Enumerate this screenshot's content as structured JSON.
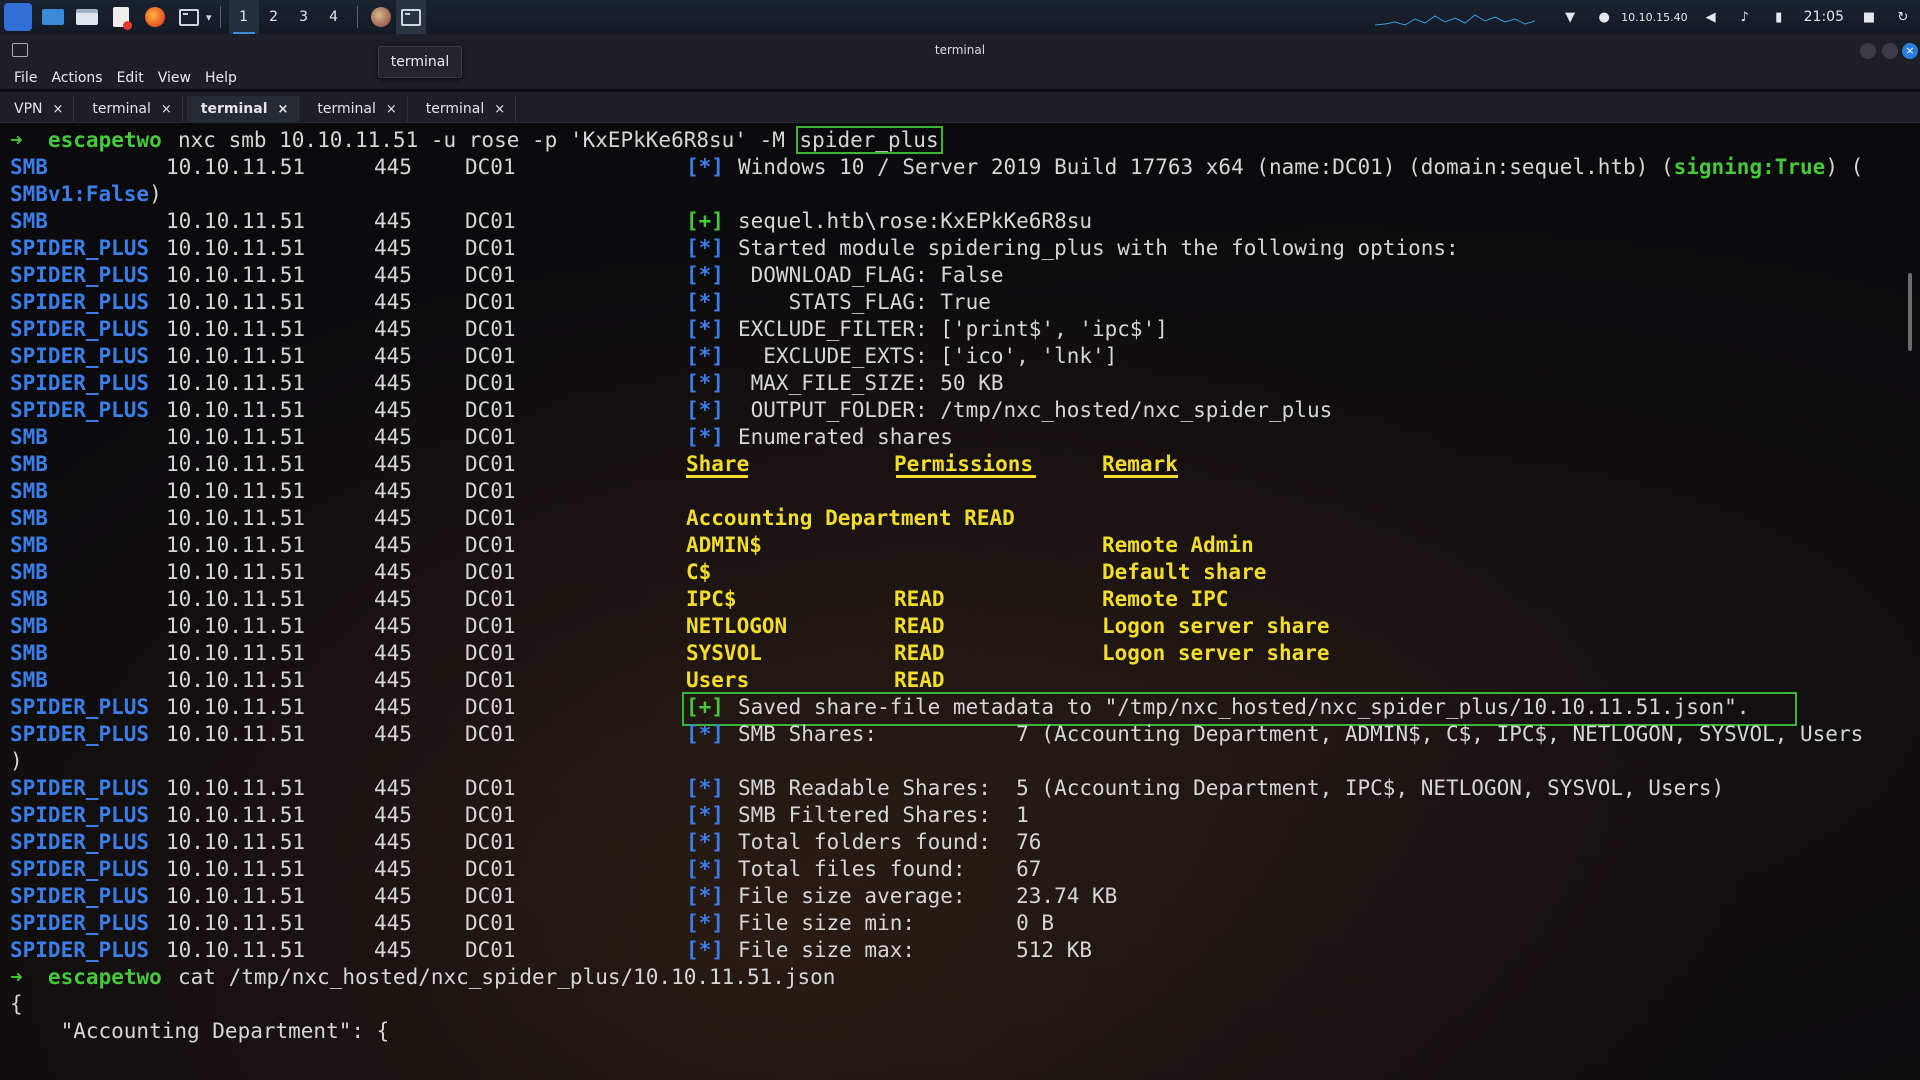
{
  "panel": {
    "workspaces": [
      "1",
      "2",
      "3",
      "4"
    ],
    "active_workspace": "1",
    "ip_address": "10.10.15.40",
    "clock": "21:05",
    "icons": [
      "kali-menu-icon",
      "desktop-icon",
      "file-manager-icon",
      "text-editor-icon",
      "firefox-icon",
      "terminal-icon",
      "wifi-icon",
      "vpn-user-icon",
      "volume-icon",
      "bell-icon",
      "battery-icon",
      "lock-icon",
      "refresh-icon"
    ]
  },
  "window": {
    "title": "terminal",
    "tooltip": "terminal",
    "menu": [
      "File",
      "Actions",
      "Edit",
      "View",
      "Help"
    ],
    "tabs": [
      {
        "label": "VPN",
        "active": false
      },
      {
        "label": "terminal",
        "active": false
      },
      {
        "label": "terminal",
        "active": true
      },
      {
        "label": "terminal",
        "active": false
      },
      {
        "label": "terminal",
        "active": false
      }
    ],
    "close_glyph": "×"
  },
  "terminal": {
    "prompt_arrow": "➜",
    "prompt_name": "escapetwo",
    "command1": "nxc smb 10.10.11.51 -u rose -p 'KxEPkKe6R8su' -M ",
    "command1_highlight": "spider_plus",
    "command2": "cat /tmp/nxc_hosted/nxc_spider_plus/10.10.11.51.json",
    "ip": "10.10.11.51",
    "port": "445",
    "host": "DC01",
    "info_tag": "[*]",
    "plus_tag": "[+]",
    "line_os": "Windows 10 / Server 2019 Build 17763 x64 (name:DC01) (domain:sequel.htb) (",
    "line_os_signing": "signing:True",
    "line_os_end": ") (",
    "line_os_wrap": "SMBv1:False",
    "line_os_wrap_end": ")",
    "creds": "sequel.htb\\rose:KxEPkKe6R8su",
    "module_lines": [
      {
        "prefix": "SPIDER_PLUS",
        "text": "Started module spidering_plus with the following options:"
      },
      {
        "prefix": "SPIDER_PLUS",
        "text": " DOWNLOAD_FLAG: False"
      },
      {
        "prefix": "SPIDER_PLUS",
        "text": "    STATS_FLAG: True"
      },
      {
        "prefix": "SPIDER_PLUS",
        "text": "EXCLUDE_FILTER: ['print$', 'ipc$']"
      },
      {
        "prefix": "SPIDER_PLUS",
        "text": "  EXCLUDE_EXTS: ['ico', 'lnk']"
      },
      {
        "prefix": "SPIDER_PLUS",
        "text": " MAX_FILE_SIZE: 50 KB"
      },
      {
        "prefix": "SPIDER_PLUS",
        "text": " OUTPUT_FOLDER: /tmp/nxc_hosted/nxc_spider_plus"
      }
    ],
    "enumerated": "Enumerated shares",
    "share_headers": [
      "Share",
      "Permissions",
      "Remark"
    ],
    "shares": [
      {
        "share": "Accounting Department",
        "perm": "READ",
        "remark": ""
      },
      {
        "share": "ADMIN$",
        "perm": "",
        "remark": "Remote Admin"
      },
      {
        "share": "C$",
        "perm": "",
        "remark": "Default share"
      },
      {
        "share": "IPC$",
        "perm": "READ",
        "remark": "Remote IPC"
      },
      {
        "share": "NETLOGON",
        "perm": "READ",
        "remark": "Logon server share"
      },
      {
        "share": "SYSVOL",
        "perm": "READ",
        "remark": "Logon server share"
      },
      {
        "share": "Users",
        "perm": "READ",
        "remark": ""
      }
    ],
    "saved": "Saved share-file metadata to \"/tmp/nxc_hosted/nxc_spider_plus/10.10.11.51.json\".",
    "smb_shares": "SMB Shares:           7 (Accounting Department, ADMIN$, C$, IPC$, NETLOGON, SYSVOL, Users",
    "smb_shares_wrap": ")",
    "stats": [
      "SMB Readable Shares:  5 (Accounting Department, IPC$, NETLOGON, SYSVOL, Users)",
      "SMB Filtered Shares:  1",
      "Total folders found:  76",
      "Total files found:    67",
      "File size average:    23.74 KB",
      "File size min:        0 B",
      "File size max:        512 KB"
    ],
    "json_open": "{",
    "json_key": "    \"Accounting Department\": {",
    "prefix_smb": "SMB",
    "prefix_spider": "SPIDER_PLUS"
  }
}
